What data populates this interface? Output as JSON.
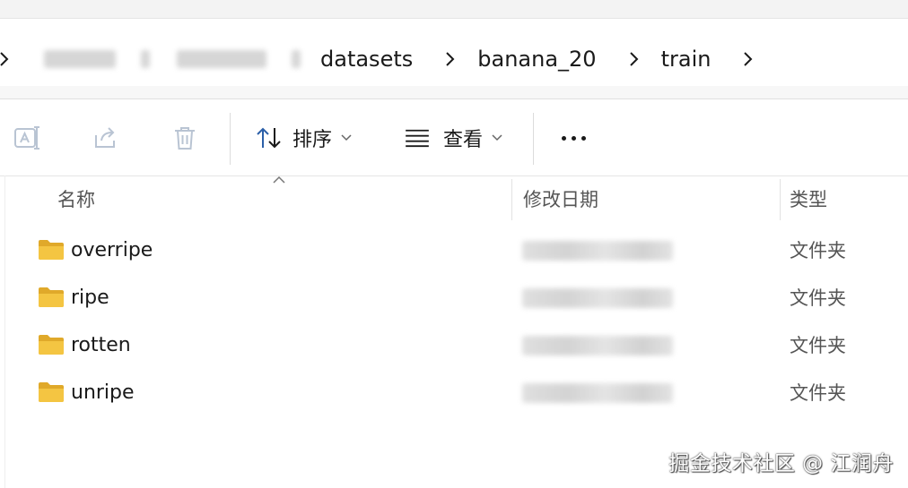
{
  "breadcrumb": {
    "items": [
      "datasets",
      "banana_20",
      "train"
    ]
  },
  "toolbar": {
    "rename_icon": "rename-icon",
    "share_icon": "share-icon",
    "delete_icon": "trash-icon",
    "sort_label": "排序",
    "view_label": "查看",
    "more_icon": "more-icon"
  },
  "columns": {
    "name": "名称",
    "date": "修改日期",
    "type": "类型"
  },
  "files": [
    {
      "name": "overripe",
      "type": "文件夹",
      "icon": "folder-icon"
    },
    {
      "name": "ripe",
      "type": "文件夹",
      "icon": "folder-icon"
    },
    {
      "name": "rotten",
      "type": "文件夹",
      "icon": "folder-icon"
    },
    {
      "name": "unripe",
      "type": "文件夹",
      "icon": "folder-icon"
    }
  ],
  "watermark": "掘金技术社区 @ 江润舟",
  "colors": {
    "folder": "#f4c542",
    "folder_dark": "#e0a92a",
    "disabled_icon": "#b9c4d3",
    "text": "#1a1a1a",
    "muted_text": "#555555"
  }
}
